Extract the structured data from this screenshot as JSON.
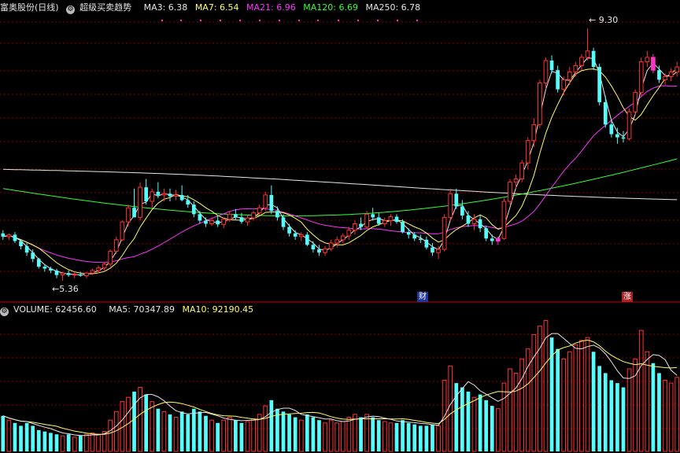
{
  "header": {
    "stock_name": "富奥股份(日线)",
    "indicator": "超级买卖趋势",
    "ma3": "MA3: 6.38",
    "ma7": "MA7: 6.54",
    "ma21": "MA21: 6.96",
    "ma120": "MA120: 6.69",
    "ma250": "MA250: 6.78"
  },
  "volume_header": {
    "label": "VOLUME: 62456.60",
    "ma5": "MA5: 70347.89",
    "ma10": "MA10: 92190.45"
  },
  "annotations": {
    "high": "9.30",
    "low": "5.36"
  },
  "tags": {
    "cai": "财",
    "zhang": "涨"
  },
  "colors": {
    "up": "#ff3333",
    "down": "#54fcfc",
    "signal": "#ff33cc",
    "ma3": "#e6e6e6",
    "ma7": "#ffff66",
    "ma21": "#ff33ff",
    "ma120": "#33ff33",
    "ma250": "#e6e6e6",
    "grid": "#8b0000",
    "tag_cai": "#223399",
    "tag_zhang": "#aa2222"
  },
  "chart_data": {
    "type": "candlestick",
    "price_ylim": [
      5.2,
      9.5
    ],
    "volume_ylim": [
      0,
      95000
    ],
    "candles": [
      [
        6.1,
        6.15,
        6.0,
        6.05,
        25000
      ],
      [
        6.05,
        6.1,
        6.0,
        6.08,
        22000
      ],
      [
        6.08,
        6.12,
        5.95,
        5.98,
        20000
      ],
      [
        5.98,
        6.0,
        5.85,
        5.9,
        18000
      ],
      [
        5.9,
        5.95,
        5.75,
        5.8,
        20000
      ],
      [
        5.8,
        5.85,
        5.65,
        5.7,
        18000
      ],
      [
        5.7,
        5.72,
        5.55,
        5.58,
        15000
      ],
      [
        5.58,
        5.62,
        5.5,
        5.55,
        14000
      ],
      [
        5.55,
        5.58,
        5.48,
        5.52,
        13000
      ],
      [
        5.52,
        5.55,
        5.4,
        5.45,
        12000
      ],
      [
        5.45,
        5.5,
        5.36,
        5.48,
        11000
      ],
      [
        5.48,
        5.52,
        5.42,
        5.45,
        12000
      ],
      [
        5.45,
        5.5,
        5.4,
        5.46,
        10000
      ],
      [
        5.46,
        5.5,
        5.42,
        5.44,
        11000
      ],
      [
        5.44,
        5.5,
        5.4,
        5.48,
        12000
      ],
      [
        5.48,
        5.55,
        5.45,
        5.52,
        13000
      ],
      [
        5.52,
        5.6,
        5.48,
        5.56,
        12000
      ],
      [
        5.56,
        5.65,
        5.52,
        5.62,
        14000
      ],
      [
        5.62,
        5.85,
        5.58,
        5.82,
        22000
      ],
      [
        5.82,
        6.05,
        5.78,
        6.0,
        28000
      ],
      [
        6.0,
        6.3,
        5.98,
        6.28,
        35000
      ],
      [
        6.28,
        6.55,
        6.2,
        6.5,
        38000
      ],
      [
        6.5,
        6.8,
        6.4,
        6.35,
        42000
      ],
      [
        6.35,
        6.9,
        6.3,
        6.82,
        45000
      ],
      [
        6.82,
        6.95,
        6.55,
        6.6,
        40000
      ],
      [
        6.6,
        6.8,
        6.5,
        6.75,
        35000
      ],
      [
        6.75,
        6.9,
        6.65,
        6.7,
        30000
      ],
      [
        6.7,
        6.8,
        6.6,
        6.72,
        28000
      ],
      [
        6.72,
        6.8,
        6.6,
        6.68,
        26000
      ],
      [
        6.68,
        6.78,
        6.62,
        6.7,
        24000
      ],
      [
        6.7,
        6.85,
        6.6,
        6.62,
        28000
      ],
      [
        6.62,
        6.7,
        6.5,
        6.55,
        26000
      ],
      [
        6.55,
        6.6,
        6.35,
        6.4,
        30000
      ],
      [
        6.4,
        6.45,
        6.25,
        6.3,
        28000
      ],
      [
        6.3,
        6.35,
        6.2,
        6.25,
        25000
      ],
      [
        6.25,
        6.35,
        6.22,
        6.3,
        22000
      ],
      [
        6.3,
        6.38,
        6.2,
        6.24,
        20000
      ],
      [
        6.24,
        6.35,
        6.18,
        6.32,
        22000
      ],
      [
        6.32,
        6.45,
        6.28,
        6.4,
        24000
      ],
      [
        6.4,
        6.48,
        6.3,
        6.35,
        22000
      ],
      [
        6.35,
        6.42,
        6.25,
        6.28,
        20000
      ],
      [
        6.28,
        6.38,
        6.22,
        6.34,
        21000
      ],
      [
        6.34,
        6.45,
        6.3,
        6.42,
        23000
      ],
      [
        6.42,
        6.55,
        6.38,
        6.5,
        26000
      ],
      [
        6.5,
        6.75,
        6.45,
        6.7,
        32000
      ],
      [
        6.7,
        6.85,
        6.4,
        6.45,
        36000
      ],
      [
        6.45,
        6.52,
        6.3,
        6.35,
        30000
      ],
      [
        6.35,
        6.4,
        6.15,
        6.2,
        28000
      ],
      [
        6.2,
        6.25,
        6.05,
        6.1,
        26000
      ],
      [
        6.1,
        6.15,
        6.0,
        6.05,
        24000
      ],
      [
        6.05,
        6.12,
        5.98,
        6.08,
        22000
      ],
      [
        6.08,
        6.12,
        5.9,
        5.92,
        26000
      ],
      [
        5.92,
        5.98,
        5.8,
        5.85,
        24000
      ],
      [
        5.85,
        5.92,
        5.75,
        5.8,
        22000
      ],
      [
        5.8,
        5.9,
        5.75,
        5.86,
        20000
      ],
      [
        5.86,
        6.0,
        5.82,
        5.95,
        22000
      ],
      [
        5.95,
        6.05,
        5.88,
        6.0,
        20000
      ],
      [
        6.0,
        6.1,
        5.95,
        6.06,
        21000
      ],
      [
        6.06,
        6.2,
        6.0,
        6.15,
        24000
      ],
      [
        6.15,
        6.3,
        6.08,
        6.25,
        26000
      ],
      [
        6.25,
        6.35,
        6.15,
        6.2,
        24000
      ],
      [
        6.2,
        6.45,
        6.18,
        6.4,
        26000
      ],
      [
        6.4,
        6.5,
        6.3,
        6.35,
        24000
      ],
      [
        6.35,
        6.42,
        6.22,
        6.25,
        22000
      ],
      [
        6.25,
        6.35,
        6.2,
        6.3,
        21000
      ],
      [
        6.3,
        6.4,
        6.22,
        6.36,
        20000
      ],
      [
        6.36,
        6.4,
        6.25,
        6.28,
        20000
      ],
      [
        6.28,
        6.32,
        6.1,
        6.12,
        22000
      ],
      [
        6.12,
        6.18,
        6.02,
        6.08,
        20000
      ],
      [
        6.08,
        6.12,
        5.98,
        6.02,
        19000
      ],
      [
        6.02,
        6.08,
        5.95,
        6.0,
        18000
      ],
      [
        6.0,
        6.05,
        5.85,
        5.88,
        18000
      ],
      [
        5.88,
        5.95,
        5.75,
        5.8,
        19000
      ],
      [
        5.8,
        5.9,
        5.7,
        5.85,
        18000
      ],
      [
        5.85,
        6.4,
        5.82,
        6.35,
        50000
      ],
      [
        6.35,
        6.8,
        6.3,
        6.72,
        60000
      ],
      [
        6.72,
        6.8,
        6.48,
        6.52,
        48000
      ],
      [
        6.52,
        6.62,
        6.32,
        6.38,
        45000
      ],
      [
        6.38,
        6.45,
        6.2,
        6.25,
        42000
      ],
      [
        6.25,
        6.4,
        6.15,
        6.32,
        38000
      ],
      [
        6.32,
        6.38,
        6.12,
        6.18,
        40000
      ],
      [
        6.18,
        6.22,
        5.98,
        6.02,
        36000
      ],
      [
        6.02,
        6.08,
        5.92,
        5.98,
        32000
      ],
      [
        5.98,
        6.05,
        5.92,
        6.02,
        30000
      ],
      [
        6.02,
        6.65,
        6.0,
        6.6,
        48000
      ],
      [
        6.6,
        6.95,
        6.55,
        6.9,
        58000
      ],
      [
        6.9,
        7.02,
        6.8,
        6.95,
        55000
      ],
      [
        6.95,
        7.25,
        6.9,
        7.2,
        65000
      ],
      [
        7.2,
        7.6,
        7.1,
        7.55,
        72000
      ],
      [
        7.55,
        7.9,
        7.45,
        7.8,
        82000
      ],
      [
        7.8,
        8.5,
        7.75,
        8.45,
        88000
      ],
      [
        8.45,
        8.85,
        8.35,
        8.8,
        92000
      ],
      [
        8.8,
        8.88,
        8.6,
        8.65,
        80000
      ],
      [
        8.65,
        8.72,
        8.3,
        8.35,
        72000
      ],
      [
        8.35,
        8.55,
        8.25,
        8.5,
        65000
      ],
      [
        8.5,
        8.7,
        8.42,
        8.62,
        70000
      ],
      [
        8.62,
        8.78,
        8.55,
        8.72,
        75000
      ],
      [
        8.72,
        8.9,
        8.65,
        8.85,
        78000
      ],
      [
        8.85,
        9.3,
        8.8,
        8.95,
        80000
      ],
      [
        8.95,
        9.0,
        8.65,
        8.7,
        70000
      ],
      [
        8.7,
        8.75,
        8.1,
        8.15,
        60000
      ],
      [
        8.15,
        8.25,
        7.75,
        7.8,
        55000
      ],
      [
        7.8,
        7.85,
        7.6,
        7.65,
        50000
      ],
      [
        7.65,
        7.75,
        7.5,
        7.6,
        48000
      ],
      [
        7.6,
        7.7,
        7.52,
        7.58,
        45000
      ],
      [
        7.58,
        8.05,
        7.55,
        8.0,
        58000
      ],
      [
        8.0,
        8.35,
        7.95,
        8.3,
        65000
      ],
      [
        8.3,
        8.85,
        8.25,
        8.78,
        85000
      ],
      [
        8.78,
        8.95,
        8.7,
        8.85,
        70000
      ],
      [
        8.85,
        8.9,
        8.6,
        8.65,
        62000
      ],
      [
        8.65,
        8.72,
        8.45,
        8.5,
        55000
      ],
      [
        8.5,
        8.6,
        8.42,
        8.55,
        50000
      ],
      [
        8.55,
        8.68,
        8.48,
        8.62,
        48000
      ],
      [
        8.62,
        8.78,
        8.55,
        8.7,
        52000
      ]
    ],
    "signal_bars": [
      83,
      109
    ]
  }
}
